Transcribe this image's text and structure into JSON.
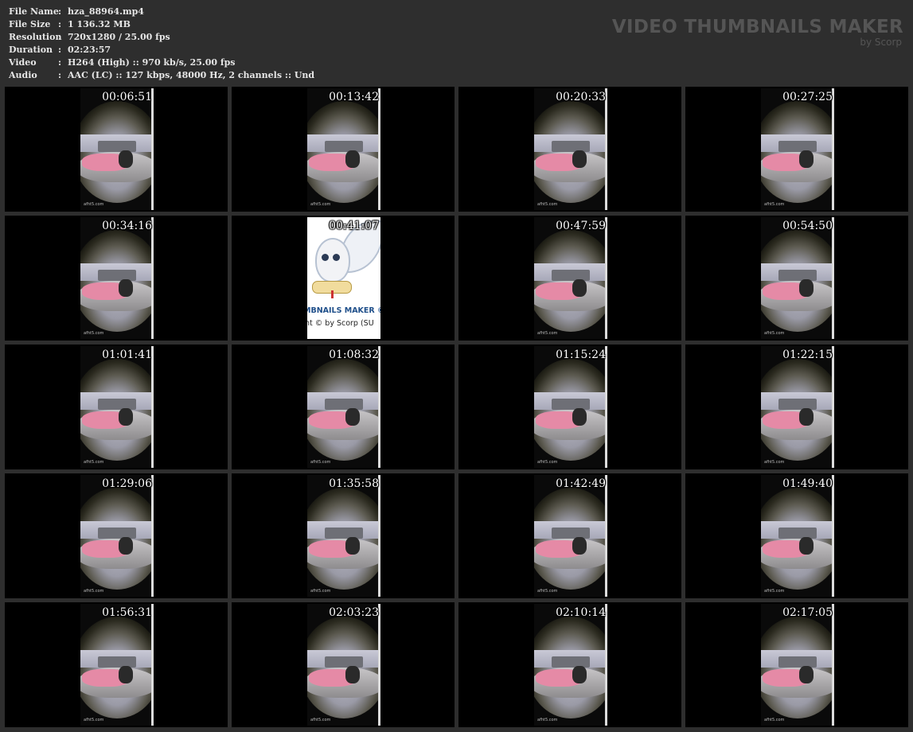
{
  "info": {
    "rows": [
      {
        "key": "File Name",
        "value": "hza_88964.mp4"
      },
      {
        "key": "File Size",
        "value": "1 136.32 MB"
      },
      {
        "key": "Resolution",
        "value": "720x1280 / 25.00 fps"
      },
      {
        "key": "Duration",
        "value": "02:23:57"
      },
      {
        "key": "Video",
        "value": "H264 (High) :: 970 kb/s, 25.00 fps"
      },
      {
        "key": "Audio",
        "value": "AAC (LC) :: 127 kbps, 48000 Hz, 2 channels :: Und"
      }
    ],
    "separator": ":"
  },
  "brand": {
    "title": "VIDEO THUMBNAILS MAKER",
    "subtitle": "by Scorp"
  },
  "thumbnails": [
    {
      "time": "00:06:51"
    },
    {
      "time": "00:13:42"
    },
    {
      "time": "00:20:33"
    },
    {
      "time": "00:27:25"
    },
    {
      "time": "00:34:16"
    },
    {
      "time": "00:41:07"
    },
    {
      "time": "00:47:59"
    },
    {
      "time": "00:54:50"
    },
    {
      "time": "01:01:41"
    },
    {
      "time": "01:08:32"
    },
    {
      "time": "01:15:24"
    },
    {
      "time": "01:22:15"
    },
    {
      "time": "01:29:06"
    },
    {
      "time": "01:35:58"
    },
    {
      "time": "01:42:49"
    },
    {
      "time": "01:49:40"
    },
    {
      "time": "01:56:31"
    },
    {
      "time": "02:03:23"
    },
    {
      "time": "02:10:14"
    },
    {
      "time": "02:17:05"
    }
  ],
  "splash": {
    "title": "MBNAILS MAKER ©",
    "copyright": "nt © by Scorp (SU"
  },
  "watermark": "afht5.com",
  "colors": {
    "background": "#2e2e2e",
    "cell": "#000000",
    "info_text": "#e6e6e6",
    "brand": "#555555",
    "timestamp": "#ffffff"
  }
}
